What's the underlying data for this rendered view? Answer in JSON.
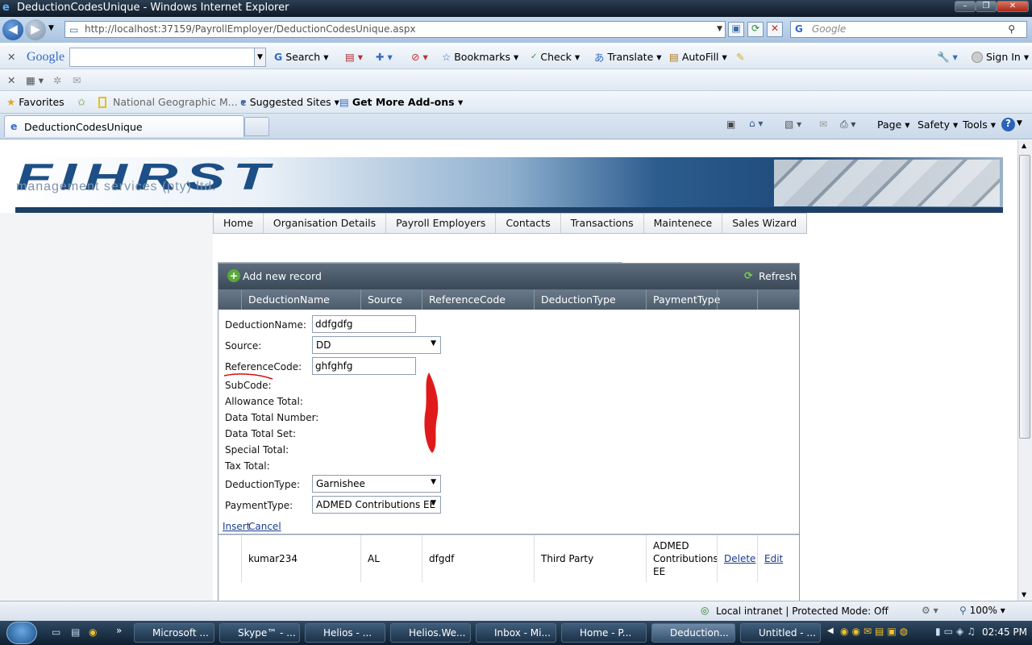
{
  "window": {
    "title": "DeductionCodesUnique - Windows Internet Explorer"
  },
  "address": {
    "url": "http://localhost:37159/PayrollEmployer/DeductionCodesUnique.aspx",
    "search_placeholder": "Google"
  },
  "google_toolbar": {
    "brand": "Google",
    "items": [
      "Search",
      "Bookmarks",
      "Check",
      "Translate",
      "AutoFill"
    ],
    "sign_in": "Sign In"
  },
  "favorites_bar": {
    "favorites": "Favorites",
    "items": [
      "National Geographic M...",
      "Suggested Sites",
      "Get More Add-ons"
    ]
  },
  "tab": {
    "title": "DeductionCodesUnique"
  },
  "command_bar": [
    "Page",
    "Safety",
    "Tools"
  ],
  "site": {
    "logo": "FIHRST",
    "logo_sub": "management services (pty) ltd.",
    "menu": [
      "Home",
      "Organisation Details",
      "Payroll Employers",
      "Contacts",
      "Transactions",
      "Maintenece",
      "Sales Wizard"
    ]
  },
  "grid": {
    "add_new": "Add new record",
    "refresh": "Refresh",
    "columns": [
      "DeductionName",
      "Source",
      "ReferenceCode",
      "DeductionType",
      "PaymentType"
    ],
    "form": {
      "deduction_name_label": "DeductionName:",
      "deduction_name_value": "ddfgdfg",
      "source_label": "Source:",
      "source_value": "DD",
      "reference_code_label": "ReferenceCode:",
      "reference_code_value": "ghfghfg",
      "subcode_label": "SubCode:",
      "allowance_total_label": "Allowance Total:",
      "data_total_number_label": "Data Total Number:",
      "data_total_set_label": "Data Total Set:",
      "special_total_label": "Special Total:",
      "tax_total_label": "Tax Total:",
      "deduction_type_label": "DeductionType:",
      "deduction_type_value": "Garnishee",
      "payment_type_label": "PaymentType:",
      "payment_type_value": "ADMED Contributions EE",
      "insert": "Insert",
      "cancel": "Cancel"
    },
    "rows": [
      {
        "name": "kumar234",
        "source": "AL",
        "ref": "dfgdf",
        "type": "Third Party",
        "payment": "ADMED Contributions EE",
        "delete": "Delete",
        "edit": "Edit"
      }
    ]
  },
  "status": {
    "zone": "Local intranet | Protected Mode: Off",
    "zoom": "100%"
  },
  "taskbar": {
    "items": [
      "Microsoft ...",
      "Skype™ - ...",
      "Helios - ...",
      "Helios.We...",
      "Inbox - Mi...",
      "Home - P...",
      "Deduction...",
      "Untitled - ..."
    ],
    "clock": "02:45 PM"
  }
}
